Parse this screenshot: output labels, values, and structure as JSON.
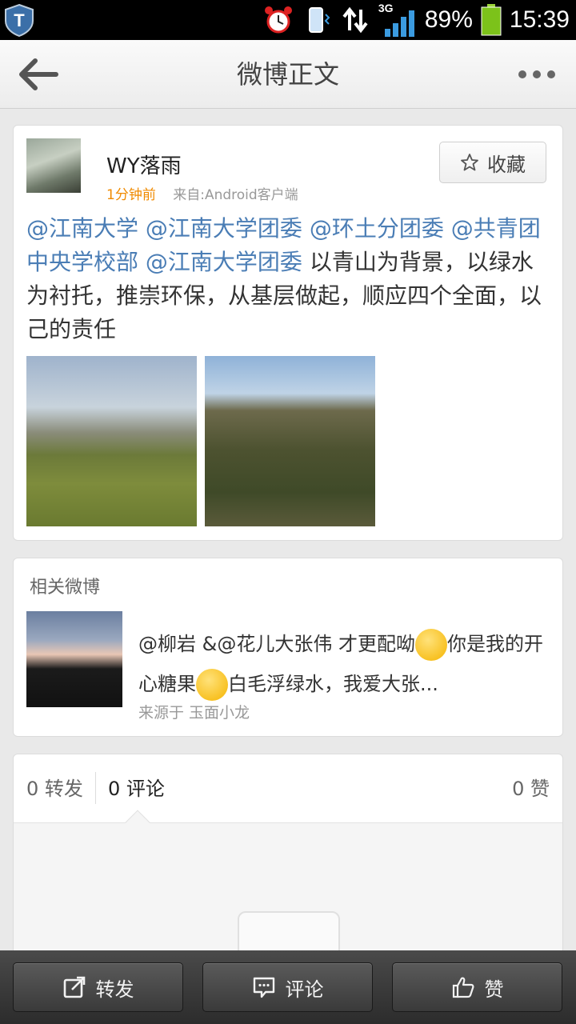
{
  "status_bar": {
    "network": "3G",
    "battery": "89%",
    "time": "15:39",
    "icons": [
      "shield-icon",
      "alarm-icon",
      "vibrate-icon",
      "data-transfer-icon",
      "signal-icon",
      "battery-icon"
    ]
  },
  "nav": {
    "title": "微博正文",
    "back_icon": "back-arrow-icon",
    "more_icon": "more-icon"
  },
  "post": {
    "username": "WY落雨",
    "time": "1分钟前",
    "source": "来自:Android客户端",
    "favorite_label": "收藏",
    "mentions": [
      "@江南大学",
      "@江南大学团委",
      "@环土分团委",
      "@共青团中央学校部",
      "@江南大学团委"
    ],
    "body": "以青山为背景，以绿水为衬托，推崇环保，从基层做起，顺应四个全面，以己的责任"
  },
  "related": {
    "header": "相关微博",
    "text_part1": "@柳岩 &@花儿大张伟 才更配呦",
    "text_part2": "你是我的开心糖果",
    "text_part3": "白毛浮绿水，我爱大张...",
    "source": "来源于 玉面小龙"
  },
  "stats": {
    "reposts": "0 转发",
    "comments": "0 评论",
    "likes": "0 赞"
  },
  "toolbar": {
    "repost_label": "转发",
    "comment_label": "评论",
    "like_label": "赞"
  },
  "colors": {
    "mention": "#4a7db5",
    "time_orange": "#f08a00",
    "toolbar_bg": "#333333"
  }
}
